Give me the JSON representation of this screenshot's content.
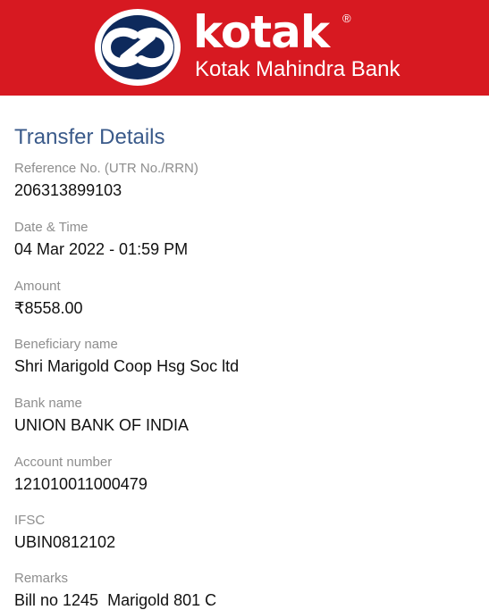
{
  "header": {
    "brand": "kotak",
    "registered": "®",
    "bank_name": "Kotak Mahindra Bank",
    "bg_color": "#d71921",
    "logo_icon": "kotak-infinity-logo-icon"
  },
  "section": {
    "title": "Transfer Details"
  },
  "fields": [
    {
      "label": "Reference No. (UTR No./RRN)",
      "value": "206313899103"
    },
    {
      "label": "Date & Time",
      "value": "04 Mar 2022 - 01:59 PM"
    },
    {
      "label": "Amount",
      "value": "₹8558.00"
    },
    {
      "label": "Beneficiary name",
      "value": "Shri Marigold Coop Hsg Soc ltd"
    },
    {
      "label": "Bank name",
      "value": "UNION BANK OF INDIA"
    },
    {
      "label": "Account number",
      "value": "121010011000479"
    },
    {
      "label": "IFSC",
      "value": "UBIN0812102"
    },
    {
      "label": "Remarks",
      "value": "Bill no 1245  Marigold 801 C"
    }
  ]
}
